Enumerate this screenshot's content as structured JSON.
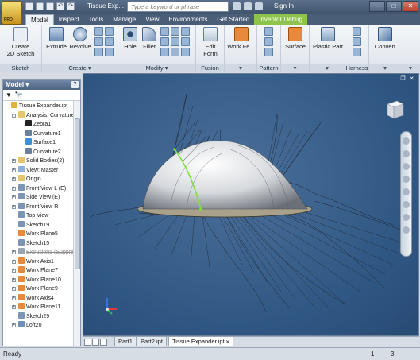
{
  "titlebar": {
    "doc_title": "Tissue Exp...",
    "search_placeholder": "Type a keyword or phrase",
    "signin_label": "Sign In",
    "app_edition": "PRO"
  },
  "tabs": [
    {
      "label": "Model"
    },
    {
      "label": "Inspect"
    },
    {
      "label": "Tools"
    },
    {
      "label": "Manage"
    },
    {
      "label": "View"
    },
    {
      "label": "Environments"
    },
    {
      "label": "Get Started"
    },
    {
      "label": "Inventor Debug"
    }
  ],
  "ribbon": {
    "sketch": {
      "title": "Sketch",
      "create_label": "Create\n2D Sketch"
    },
    "create": {
      "title": "Create",
      "extrude": "Extrude",
      "revolve": "Revolve"
    },
    "modify": {
      "title": "Modify",
      "hole": "Hole",
      "fillet": "Fillet"
    },
    "fusion": {
      "title": "Fusion",
      "edit_form": "Edit\nForm"
    },
    "work_features": {
      "label": "Work Fe..."
    },
    "pattern": {
      "title": "Pattern"
    },
    "surface": {
      "label": "Surface"
    },
    "plastic": {
      "label": "Plastic Part"
    },
    "harness": {
      "title": "Harness"
    },
    "convert": {
      "label": "Convert"
    }
  },
  "browser": {
    "title": "Model",
    "help": "?",
    "nodes": [
      {
        "label": "Tissue Expander.ipt",
        "indent": 0,
        "exp": "",
        "icon": "part-icon"
      },
      {
        "label": "Analysis: Curvature",
        "indent": 1,
        "exp": "-",
        "icon": "folder-icon"
      },
      {
        "label": "Zebra1",
        "indent": 2,
        "exp": "",
        "icon": "zebra-icon"
      },
      {
        "label": "Curvature1",
        "indent": 2,
        "exp": "",
        "icon": "curvature-icon"
      },
      {
        "label": "Surface1",
        "indent": 2,
        "exp": "",
        "icon": "surface-analysis-icon"
      },
      {
        "label": "Curvature2",
        "indent": 2,
        "exp": "",
        "icon": "curvature-checked-icon"
      },
      {
        "label": "Solid Bodies(2)",
        "indent": 1,
        "exp": "+",
        "icon": "folder-icon"
      },
      {
        "label": "View: Master",
        "indent": 1,
        "exp": "+",
        "icon": "view-icon"
      },
      {
        "label": "Origin",
        "indent": 1,
        "exp": "+",
        "icon": "folder-icon"
      },
      {
        "label": "Front View L (E)",
        "indent": 1,
        "exp": "+",
        "icon": "sketch-icon"
      },
      {
        "label": "Side View (E)",
        "indent": 1,
        "exp": "+",
        "icon": "sketch-icon"
      },
      {
        "label": "Front View R",
        "indent": 1,
        "exp": "+",
        "icon": "sketch-icon"
      },
      {
        "label": "Top View",
        "indent": 1,
        "exp": "",
        "icon": "sketch-icon"
      },
      {
        "label": "Sketch19",
        "indent": 1,
        "exp": "",
        "icon": "sketch-icon"
      },
      {
        "label": "Work Plane5",
        "indent": 1,
        "exp": "",
        "icon": "workplane-icon"
      },
      {
        "label": "Sketch15",
        "indent": 1,
        "exp": "",
        "icon": "sketch-icon"
      },
      {
        "label": "Extrusion5 (Suppressed)",
        "indent": 1,
        "exp": "+",
        "icon": "extrusion-icon",
        "struck": true
      },
      {
        "label": "Work Axis1",
        "indent": 1,
        "exp": "+",
        "icon": "workaxis-icon"
      },
      {
        "label": "Work Plane7",
        "indent": 1,
        "exp": "+",
        "icon": "workplane-icon"
      },
      {
        "label": "Work Plane10",
        "indent": 1,
        "exp": "+",
        "icon": "workplane-icon"
      },
      {
        "label": "Work Plane9",
        "indent": 1,
        "exp": "+",
        "icon": "workplane-icon"
      },
      {
        "label": "Work Axis4",
        "indent": 1,
        "exp": "+",
        "icon": "workaxis-icon"
      },
      {
        "label": "Work Plane11",
        "indent": 1,
        "exp": "+",
        "icon": "workplane-icon"
      },
      {
        "label": "Sketch29",
        "indent": 1,
        "exp": "",
        "icon": "sketch-icon"
      },
      {
        "label": "Loft20",
        "indent": 1,
        "exp": "+",
        "icon": "loft-icon"
      }
    ]
  },
  "doctabs": [
    {
      "label": "Part1",
      "active": false
    },
    {
      "label": "Part2.ipt",
      "active": false
    },
    {
      "label": "Tissue Expander.ipt",
      "active": true
    }
  ],
  "status": {
    "text": "Ready",
    "value1": "1",
    "value2": "3"
  },
  "colors": {
    "viewport_bg": "#2f5682",
    "highlight_curve": "#7fe23a",
    "ribbon_bg": "#dfe5ec",
    "special_tab": "#8fc44a"
  }
}
